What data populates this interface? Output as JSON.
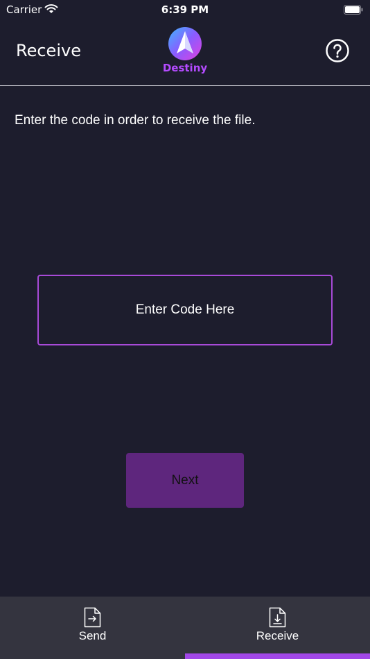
{
  "status_bar": {
    "carrier": "Carrier",
    "time": "6:39 PM"
  },
  "header": {
    "title": "Receive",
    "logo_text": "Destiny",
    "help_icon": "question-circle-icon"
  },
  "main": {
    "instruction": "Enter the code in order to receive the file.",
    "code_input": {
      "value": "",
      "placeholder": "Enter Code Here"
    },
    "next_label": "Next"
  },
  "tab_bar": {
    "tabs": [
      {
        "label": "Send",
        "icon": "file-send-icon",
        "active": false
      },
      {
        "label": "Receive",
        "icon": "file-download-icon",
        "active": true
      }
    ]
  },
  "colors": {
    "background": "#1d1d2d",
    "accent": "#a247e8",
    "button": "#5e267d",
    "tab_bar": "#34343f"
  }
}
